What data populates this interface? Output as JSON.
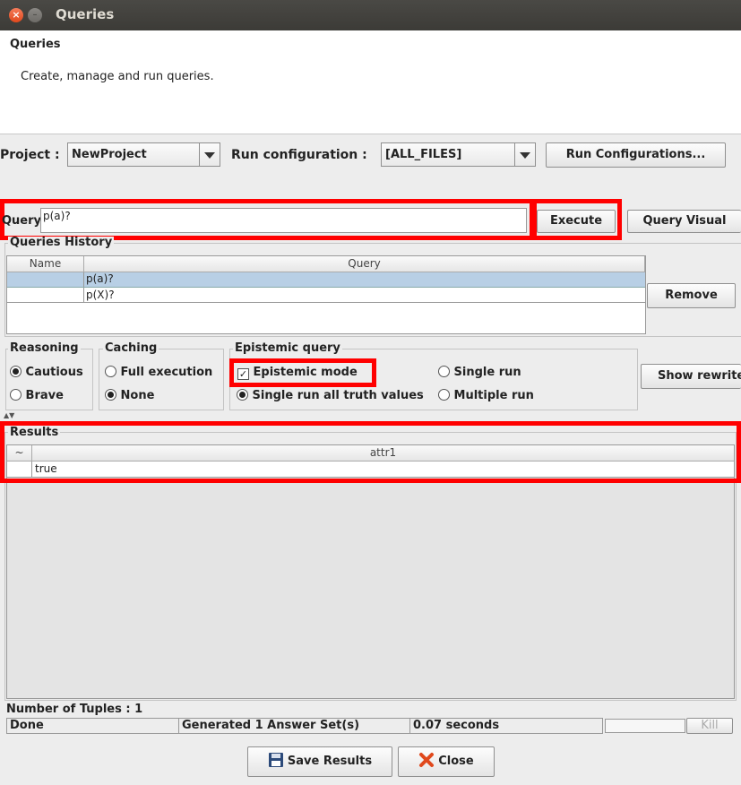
{
  "window": {
    "title": "Queries",
    "close_glyph": "×",
    "min_glyph": "–"
  },
  "header": {
    "title": "Queries",
    "subtitle": "Create, manage and run queries."
  },
  "project": {
    "label": "Project :",
    "value": "NewProject"
  },
  "run_config": {
    "label": "Run configuration :",
    "value": "[ALL_FILES]",
    "button": "Run Configurations..."
  },
  "query": {
    "label": "Query",
    "value": "p(a)?",
    "execute": "Execute",
    "visual": "Query Visual"
  },
  "history": {
    "title": "Queries History",
    "columns": [
      "Name",
      "Query"
    ],
    "rows": [
      {
        "name": "",
        "query": "p(a)?"
      },
      {
        "name": "",
        "query": "p(X)?"
      }
    ],
    "remove": "Remove"
  },
  "reasoning": {
    "title": "Reasoning",
    "options": [
      "Cautious",
      "Brave"
    ],
    "selected": "Cautious"
  },
  "caching": {
    "title": "Caching",
    "options": [
      "Full execution",
      "None"
    ],
    "selected": "None"
  },
  "epistemic": {
    "title": "Epistemic query",
    "mode_label": "Epistemic mode",
    "mode_checked": true,
    "options": [
      "Single run",
      "Single run all truth values",
      "Multiple run"
    ],
    "selected": "Single run all truth values"
  },
  "show_rewrite": "Show rewrite",
  "results": {
    "title": "Results",
    "columns": [
      "~",
      "attr1"
    ],
    "rows": [
      [
        "",
        "true"
      ]
    ]
  },
  "tuples": {
    "label": "Number of Tuples : 1"
  },
  "status": {
    "state": "Done",
    "message": "Generated 1 Answer Set(s)",
    "time": "0.07 seconds",
    "kill": "Kill"
  },
  "footer": {
    "save": "Save Results",
    "close": "Close"
  },
  "colors": {
    "highlight": "#ff0000",
    "selected_row": "#b8cfe5"
  }
}
